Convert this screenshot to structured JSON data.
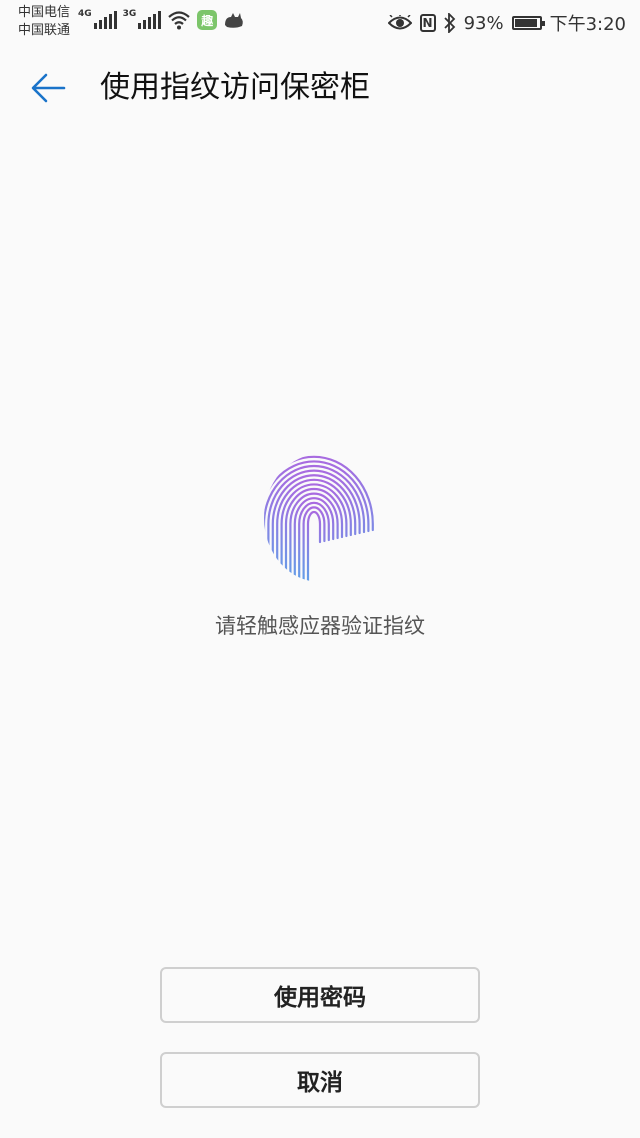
{
  "status_bar": {
    "carrier_1": "中国电信",
    "carrier_2": "中国联通",
    "network_1": "4G",
    "network_2": "3G",
    "app_badge": "趣",
    "battery_percent": "93%",
    "battery_level": 0.93,
    "time": "下午3:20",
    "nfc": "N",
    "icons": [
      "signal-icon",
      "wifi-icon",
      "app-icon",
      "cat-icon",
      "eye-icon",
      "nfc-icon",
      "bluetooth-icon",
      "battery-icon"
    ]
  },
  "header": {
    "title": "使用指纹访问保密柜",
    "back_icon": "arrow-left-icon"
  },
  "fingerprint": {
    "icon": "fingerprint-icon",
    "prompt": "请轻触感应器验证指纹",
    "gradient_top": "#a86be0",
    "gradient_bottom": "#5fa0e8"
  },
  "actions": {
    "use_password": "使用密码",
    "cancel": "取消"
  },
  "colors": {
    "accent": "#1a73c9",
    "background": "#fafafa"
  }
}
